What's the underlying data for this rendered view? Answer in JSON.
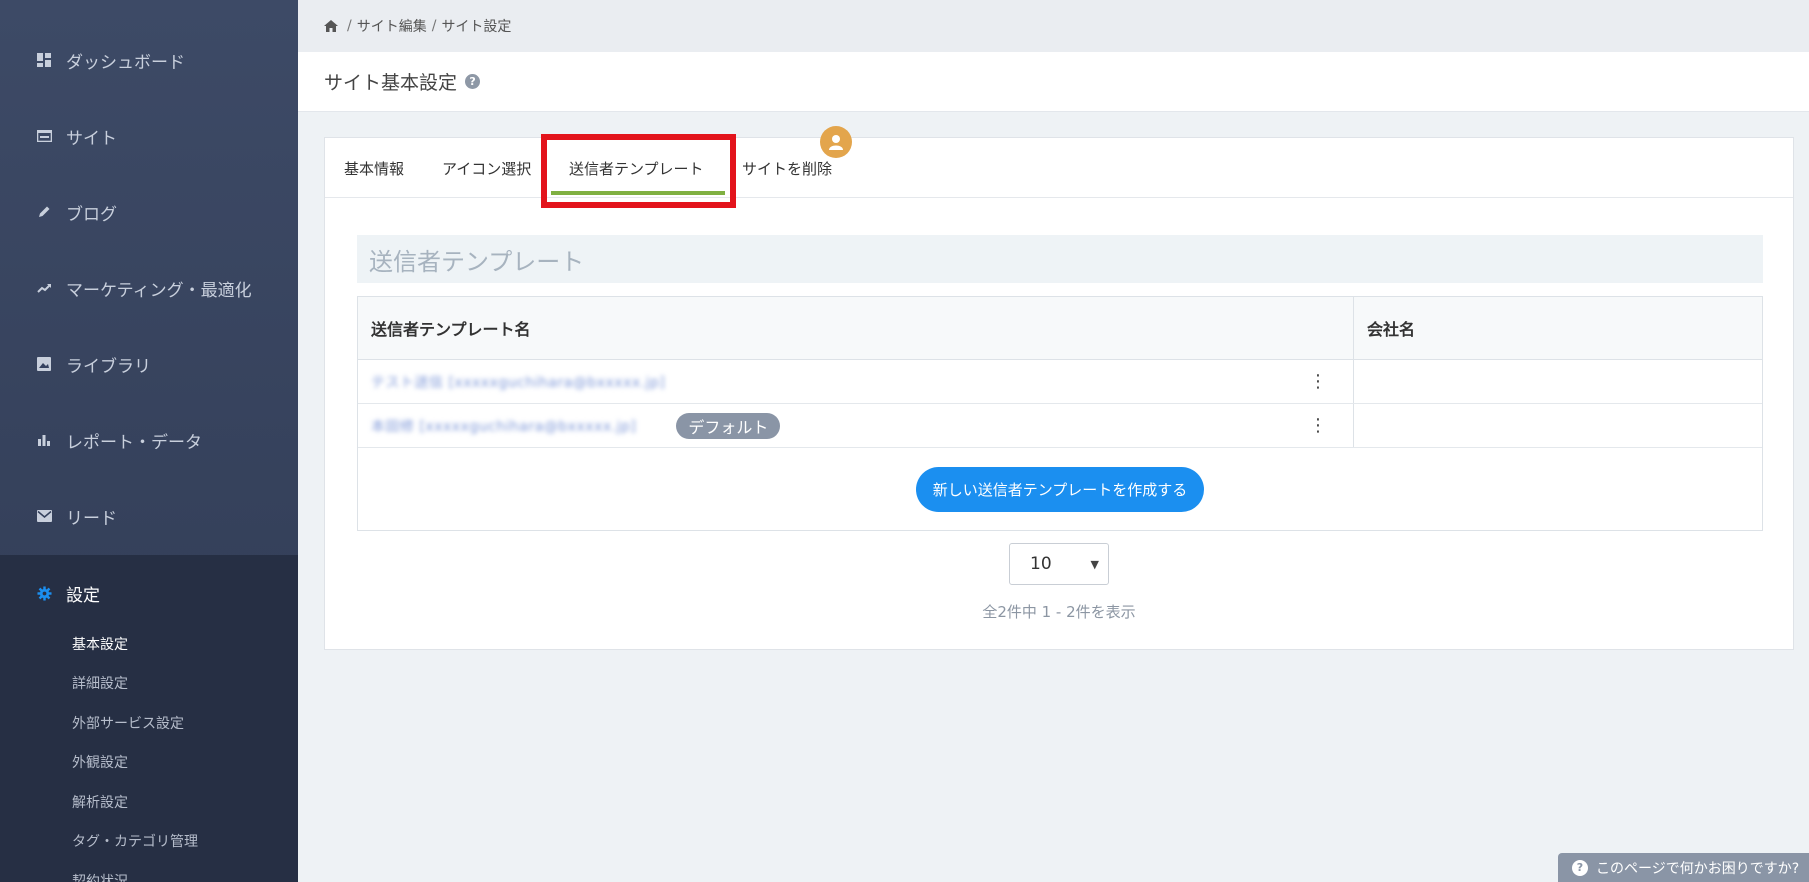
{
  "sidebar": {
    "items": [
      {
        "label": "ダッシュボード",
        "icon": "dashboard-icon"
      },
      {
        "label": "サイト",
        "icon": "site-icon"
      },
      {
        "label": "ブログ",
        "icon": "pencil-icon"
      },
      {
        "label": "マーケティング・最適化",
        "icon": "trend-icon"
      },
      {
        "label": "ライブラリ",
        "icon": "image-icon"
      },
      {
        "label": "レポート・データ",
        "icon": "bar-chart-icon"
      },
      {
        "label": "リード",
        "icon": "mail-icon"
      },
      {
        "label": "設定",
        "icon": "gear-icon"
      }
    ],
    "sub_items": [
      {
        "label": "基本設定"
      },
      {
        "label": "詳細設定"
      },
      {
        "label": "外部サービス設定"
      },
      {
        "label": "外観設定"
      },
      {
        "label": "解析設定"
      },
      {
        "label": "タグ・カテゴリ管理"
      },
      {
        "label": "契約状況"
      }
    ],
    "accent_color": "#1b8ff0"
  },
  "breadcrumb": {
    "items": [
      "サイト編集",
      "サイト設定"
    ],
    "separator": "/"
  },
  "page": {
    "title": "サイト基本設定",
    "help": "?"
  },
  "tabs": [
    {
      "label": "基本情報"
    },
    {
      "label": "アイコン選択"
    },
    {
      "label": "送信者テンプレート"
    },
    {
      "label": "サイトを削除"
    }
  ],
  "section": {
    "title": "送信者テンプレート"
  },
  "table": {
    "columns": [
      "送信者テンプレート名",
      "会社名"
    ],
    "rows": [
      {
        "name": "テスト送信 [xxxxxguchihara@bxxxxx.jp]",
        "company": "",
        "badge": ""
      },
      {
        "name": "本田修 [xxxxxguchihara@bxxxxx.jp]",
        "company": "",
        "badge": "デフォルト"
      }
    ],
    "row_menu_glyph": "⋮",
    "create_button": "新しい送信者テンプレートを作成する"
  },
  "pagination": {
    "per_page": "10",
    "summary": "全2件中 1 - 2件を表示"
  },
  "help_button": {
    "label": "このページで何かお困りですか?"
  },
  "colors": {
    "active_tab_underline": "#7fb042",
    "highlight_box": "#e3141c",
    "primary_button": "#1b8ff0",
    "badge": "#8a95a6"
  }
}
